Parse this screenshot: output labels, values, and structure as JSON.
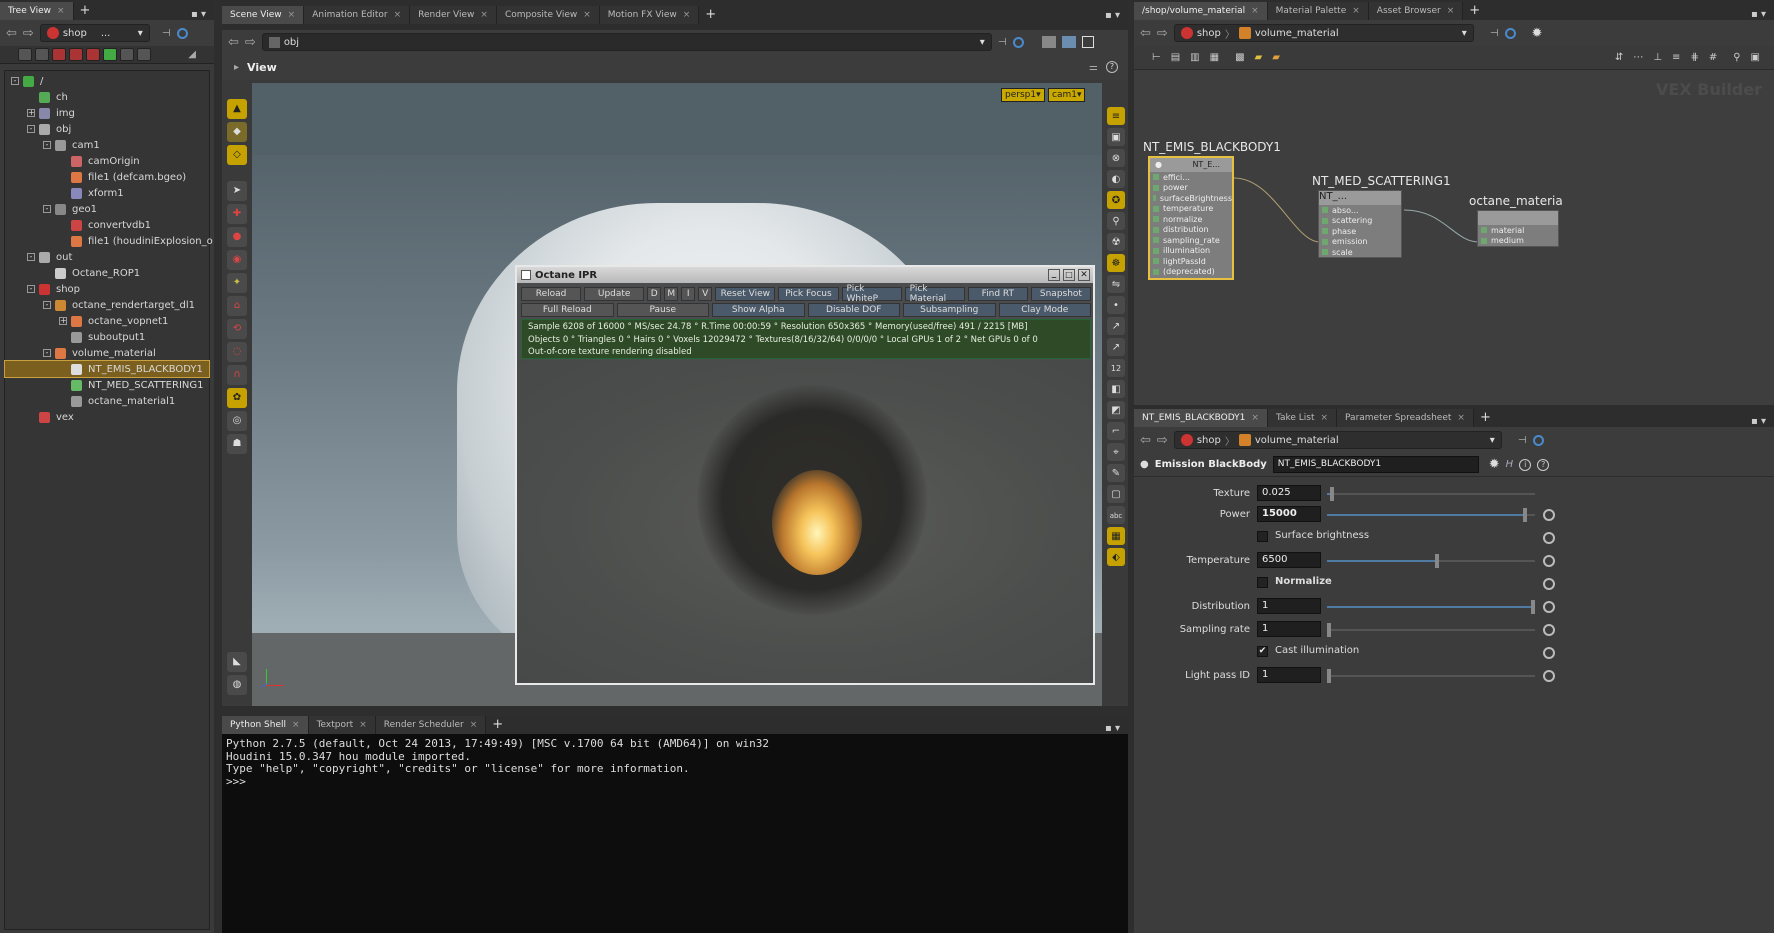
{
  "tree_panel": {
    "tab_label": "Tree View",
    "path": {
      "node": "shop",
      "more": "..."
    },
    "rows": [
      {
        "label": "/",
        "icon": "root-icon"
      },
      {
        "label": "ch",
        "icon": "channel-icon"
      },
      {
        "label": "img",
        "icon": "image-network-icon"
      },
      {
        "label": "obj",
        "icon": "object-network-icon"
      },
      {
        "label": "cam1",
        "icon": "camera-icon"
      },
      {
        "label": "camOrigin",
        "icon": "null-icon"
      },
      {
        "label": "file1 (defcam.bgeo)",
        "icon": "file-sop-icon"
      },
      {
        "label": "xform1",
        "icon": "transform-icon"
      },
      {
        "label": "geo1",
        "icon": "geometry-icon"
      },
      {
        "label": "convertvdb1",
        "icon": "vdb-icon"
      },
      {
        "label": "file1 (houdiniExplosion_o",
        "icon": "file-sop-icon"
      },
      {
        "label": "out",
        "icon": "output-network-icon"
      },
      {
        "label": "Octane_ROP1",
        "icon": "rop-icon"
      },
      {
        "label": "shop",
        "icon": "shop-network-icon"
      },
      {
        "label": "octane_rendertarget_dl1",
        "icon": "rendertarget-icon"
      },
      {
        "label": "octane_vopnet1",
        "icon": "vopnet-icon"
      },
      {
        "label": "suboutput1",
        "icon": "suboutput-icon"
      },
      {
        "label": "volume_material",
        "icon": "vopnet-icon"
      },
      {
        "label": "NT_EMIS_BLACKBODY1",
        "icon": "light-bulb-icon"
      },
      {
        "label": "NT_MED_SCATTERING1",
        "icon": "scattering-icon"
      },
      {
        "label": "octane_material1",
        "icon": "material-icon"
      },
      {
        "label": "vex",
        "icon": "vex-icon"
      }
    ]
  },
  "center_tabs": [
    "Scene View",
    "Animation Editor",
    "Render View",
    "Composite View",
    "Motion FX View"
  ],
  "scene_path": "obj",
  "view_label": "View",
  "cam_labels": [
    "persp1▾",
    "cam1▾"
  ],
  "ipr": {
    "title": "Octane IPR",
    "row1": [
      "Reload",
      "Update",
      "D",
      "M",
      "I",
      "V",
      "Reset View",
      "Pick Focus",
      "Pick WhiteP",
      "Pick Material",
      "Find RT",
      "Snapshot"
    ],
    "row2": [
      "Full Reload",
      "Pause",
      "Show Alpha",
      "Disable DOF",
      "Subsampling",
      "Clay Mode"
    ],
    "status1": "Sample 6208 of 16000 ° MS/sec 24.78 ° R.Time 00:00:59 ° Resolution 650x365 ° Memory(used/free) 491 / 2215 [MB]",
    "status2": "Objects 0 ° Triangles 0 ° Hairs 0 ° Voxels 12029472 ° Textures(8/16/32/64) 0/0/0/0 ° Local GPUs 1 of 2 ° Net GPUs 0 of 0",
    "status3": "Out-of-core texture rendering disabled"
  },
  "bottom_tabs": [
    "Python Shell",
    "Textport",
    "Render Scheduler"
  ],
  "console_lines": [
    "Python 2.7.5 (default, Oct 24 2013, 17:49:49) [MSC v.1700 64 bit (AMD64)] on win32",
    "Houdini 15.0.347 hou module imported.",
    "Type \"help\", \"copyright\", \"credits\" or \"license\" for more information.",
    ">>>"
  ],
  "network": {
    "tabs": [
      "/shop/volume_material",
      "Material Palette",
      "Asset Browser"
    ],
    "path": [
      "shop",
      "volume_material"
    ],
    "builder_label": "VEX Builder",
    "nodes": [
      {
        "title": "NT_EMIS_BLACKBODY1",
        "head": "NT_E...",
        "ports": [
          "effici...",
          "power",
          "surfaceBrightness",
          "temperature",
          "normalize",
          "distribution",
          "sampling_rate",
          "illumination",
          "lightPassId",
          "(deprecated)"
        ]
      },
      {
        "title": "NT_MED_SCATTERING1",
        "head": "NT_...",
        "ports": [
          "abso...",
          "scattering",
          "phase",
          "emission",
          "scale"
        ]
      },
      {
        "title": "octane_materia",
        "ports": [
          "material",
          "medium"
        ]
      }
    ]
  },
  "params": {
    "tabs": [
      "NT_EMIS_BLACKBODY1",
      "Take List",
      "Parameter Spreadsheet"
    ],
    "path": [
      "shop",
      "volume_material"
    ],
    "node_type": "Emission BlackBody",
    "node_name": "NT_EMIS_BLACKBODY1",
    "texture": {
      "label": "Texture",
      "value": "0.025",
      "level": 0.025
    },
    "power": {
      "label": "Power",
      "value": "15000",
      "level": 0.95
    },
    "surface_brightness": {
      "label": "Surface brightness",
      "checked": false
    },
    "temperature": {
      "label": "Temperature",
      "value": "6500",
      "level": 0.53
    },
    "normalize": {
      "label": "Normalize",
      "checked": false
    },
    "distribution": {
      "label": "Distribution",
      "value": "1",
      "level": 1.0
    },
    "sampling_rate": {
      "label": "Sampling rate",
      "value": "1",
      "level": 0.0
    },
    "cast_illumination": {
      "label": "Cast illumination",
      "checked": true,
      "mark": "✔"
    },
    "light_pass_id": {
      "label": "Light pass ID",
      "value": "1",
      "level": 0.0
    }
  }
}
